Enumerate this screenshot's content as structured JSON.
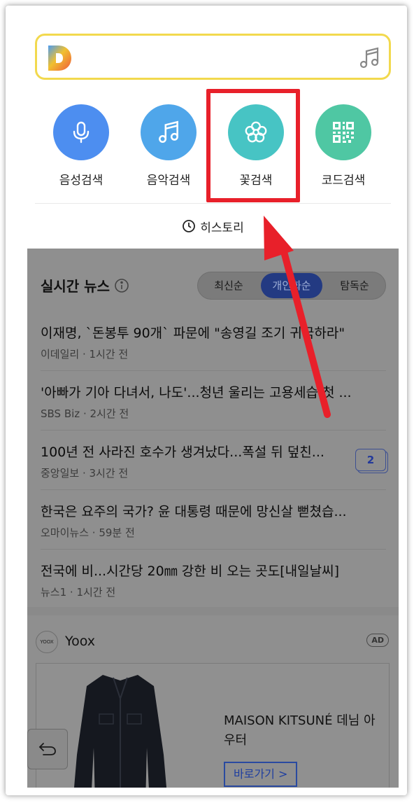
{
  "quick_search": {
    "items": [
      {
        "label": "음성검색",
        "icon": "microphone-icon",
        "color": "#4d8ef0"
      },
      {
        "label": "음악검색",
        "icon": "music-note-icon",
        "color": "#4fa6ea"
      },
      {
        "label": "꽃검색",
        "icon": "flower-icon",
        "color": "#47c4c4"
      },
      {
        "label": "코드검색",
        "icon": "qr-code-icon",
        "color": "#4fc7a3"
      }
    ],
    "history_label": "히스토리"
  },
  "news": {
    "title": "실시간 뉴스",
    "sort_tabs": [
      "최신순",
      "개인화순",
      "탐독순"
    ],
    "active_tab": "개인화순",
    "items": [
      {
        "headline": "이재명, `돈봉투 90개` 파문에 \"송영길 조기 귀국하라\"",
        "source": "이데일리",
        "time": "1시간 전"
      },
      {
        "headline": "'아빠가 기아 다녀서, 나도'...청년 울리는 고용세습 첫 ...",
        "source": "SBS Biz",
        "time": "2시간 전"
      },
      {
        "headline": "100년 전 사라진 호수가 생겨났다...폭설 뒤 덮친...",
        "source": "중앙일보",
        "time": "3시간 전",
        "related_count": "2"
      },
      {
        "headline": "한국은 요주의 국가? 윤 대통령 때문에 망신살 뻗쳤습...",
        "source": "오마이뉴스",
        "time": "59분 전"
      },
      {
        "headline": "전국에 비...시간당 20㎜ 강한 비 오는 곳도[내일날씨]",
        "source": "뉴스1",
        "time": "1시간 전"
      }
    ]
  },
  "ad": {
    "brand_logo_text": "YOOX",
    "brand": "Yoox",
    "badge": "AD",
    "product": "MAISON KITSUNÉ 데님 아우터",
    "cta": "바로가기 >"
  },
  "colors": {
    "search_border": "#f2d94e",
    "highlight": "#e8202a",
    "arrow": "#e8202a"
  }
}
